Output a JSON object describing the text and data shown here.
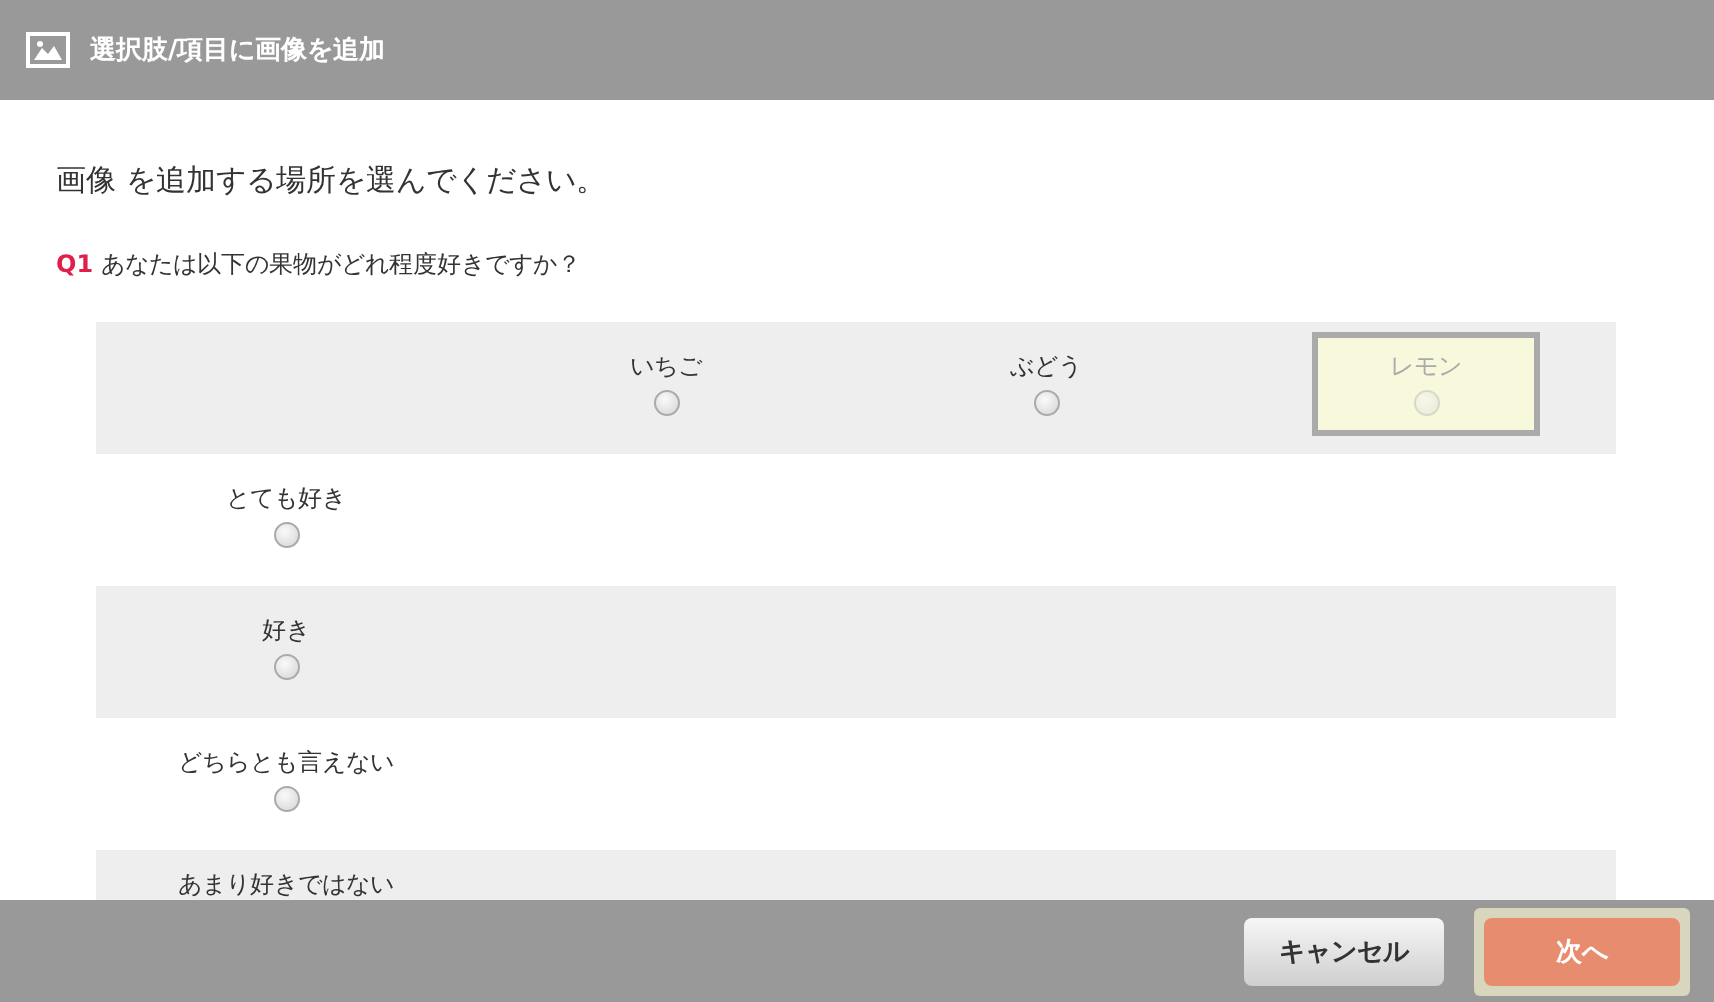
{
  "window": {
    "title": "選択肢/項目に画像を追加"
  },
  "instruction": "画像 を追加する場所を選んでください。",
  "question": {
    "number": "Q1",
    "text": "あなたは以下の果物がどれ程度好きですか？"
  },
  "columns": [
    {
      "label": "いちご",
      "selected": false
    },
    {
      "label": "ぶどう",
      "selected": false
    },
    {
      "label": "レモン",
      "selected": true
    }
  ],
  "rows": [
    {
      "label": "とても好き",
      "selected": false
    },
    {
      "label": "好き",
      "selected": false
    },
    {
      "label": "どちらとも言えない",
      "selected": false
    },
    {
      "label": "あまり好きではない",
      "selected": false
    }
  ],
  "buttons": [
    {
      "label": "キャンセル",
      "kind": "secondary"
    },
    {
      "label": "次へ",
      "kind": "primary"
    }
  ]
}
